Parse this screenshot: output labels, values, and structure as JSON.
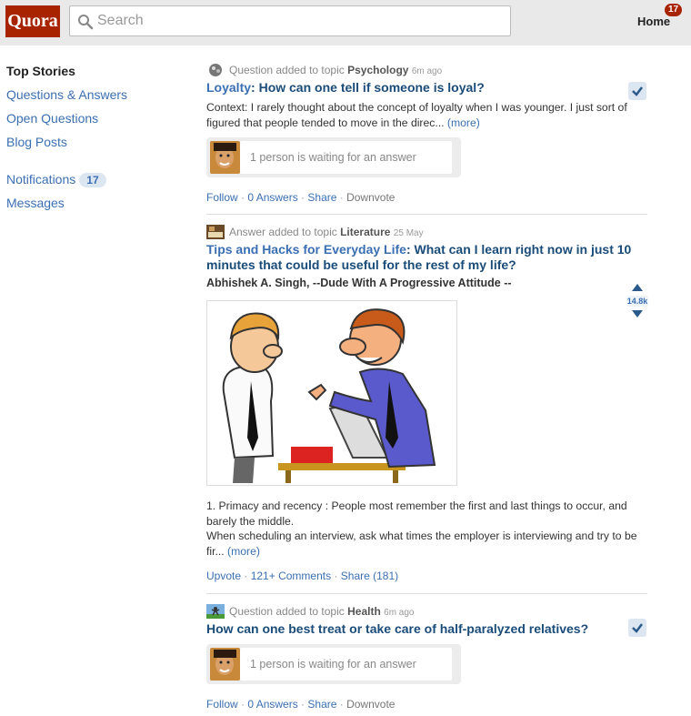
{
  "header": {
    "logo": "Quora",
    "search_placeholder": "Search",
    "home_label": "Home",
    "home_badge": "17"
  },
  "sidebar": {
    "title": "Top Stories",
    "links": [
      "Questions & Answers",
      "Open Questions",
      "Blog Posts"
    ],
    "notifications_label": "Notifications",
    "notifications_count": "17",
    "messages_label": "Messages"
  },
  "feed": [
    {
      "meta_prefix": "Question added to topic",
      "topic": "Psychology",
      "time": "6m ago",
      "category": "Loyalty",
      "question": "How can one tell if someone is loyal?",
      "excerpt": "Context: I rarely thought about the concept of loyalty when I was younger. I just sort of figured that people tended to move in the direc...",
      "more": "(more)",
      "waiting": "1 person is waiting for an answer",
      "actions": {
        "follow": "Follow",
        "answers": "0 Answers",
        "share": "Share",
        "downvote": "Downvote"
      }
    },
    {
      "meta_prefix": "Answer added to topic",
      "topic": "Literature",
      "time": "25 May",
      "category": "Tips and Hacks for Everyday Life",
      "question": "What can I learn right now in just 10 minutes that could be useful for the rest of my life?",
      "author": "Abhishek A. Singh, --Dude With A Progressive Attitude --",
      "vote_count": "14.8k",
      "excerpt_line1": "1. Primacy and recency : People most remember the first and last things to occur, and barely the middle.",
      "excerpt_line2": "When scheduling an interview, ask what times the employer is interviewing and try to be fir...",
      "more": "(more)",
      "actions": {
        "upvote": "Upvote",
        "comments": "121+ Comments",
        "share": "Share (181)"
      }
    },
    {
      "meta_prefix": "Question added to topic",
      "topic": "Health",
      "time": "6m ago",
      "question": "How can one best treat or take care of half-paralyzed relatives?",
      "waiting": "1 person is waiting for an answer",
      "actions": {
        "follow": "Follow",
        "answers": "0 Answers",
        "share": "Share",
        "downvote": "Downvote"
      }
    }
  ],
  "colors": {
    "brand": "#a82400",
    "link": "#3b6fb3",
    "title": "#1a4c7a"
  },
  "icons": [
    "search-icon",
    "checkmark-icon",
    "upvote-arrow-icon",
    "downvote-arrow-icon"
  ]
}
